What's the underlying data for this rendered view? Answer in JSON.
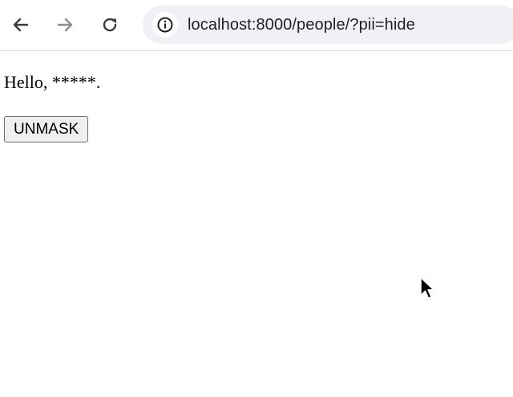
{
  "browser": {
    "url": "localhost:8000/people/?pii=hide",
    "icons": {
      "back": "arrow-left-icon",
      "forward": "arrow-right-icon",
      "reload": "reload-icon",
      "site_info": "info-icon"
    },
    "forward_enabled": false
  },
  "page": {
    "greeting": "Hello, *****.",
    "unmask_button_label": "UNMASK"
  },
  "colors": {
    "toolbar_icon": "#3c3c3c",
    "toolbar_icon_disabled": "#8e8e8e",
    "address_bar_bg": "#eff1f6",
    "button_bg": "#efefef",
    "button_border": "#6e6e6e"
  }
}
